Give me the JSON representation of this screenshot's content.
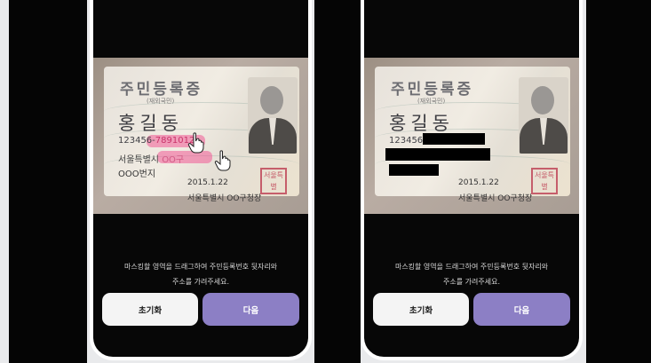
{
  "screens": [
    {
      "card": {
        "title": "주민등록증",
        "subtitle": "(재외국민)",
        "name": "홍길동",
        "number_front": "123456-",
        "number_back": "7891012",
        "address_line1_prefix": "서울특별시 ",
        "address_line1_masked": "OO구",
        "address_line2": "OOO번지",
        "issue_date": "2015.1.22",
        "issuer": "서울특별시 OO구청장",
        "stamp": "서울특별"
      },
      "instruction_line1": "마스킹할 영역을 드래그하여 주민등록번호 뒷자리와",
      "instruction_line2": "주소를 가려주세요.",
      "reset_label": "초기화",
      "next_label": "다음"
    },
    {
      "card": {
        "title": "주민등록증",
        "subtitle": "(재외국민)",
        "name": "홍길동",
        "number_front": "123456-",
        "issue_date": "2015.1.22",
        "issuer": "서울특별시 OO구청장",
        "stamp": "서울특별"
      },
      "instruction_line1": "마스킹할 영역을 드래그하여 주민등록번호 뒷자리와",
      "instruction_line2": "주소를 가려주세요.",
      "reset_label": "초기화",
      "next_label": "다음"
    }
  ],
  "colors": {
    "primary_button": "#8c7fc5",
    "highlight": "#f05a96",
    "mask": "#000000"
  },
  "icons": [
    "hand-pointer-icon"
  ]
}
